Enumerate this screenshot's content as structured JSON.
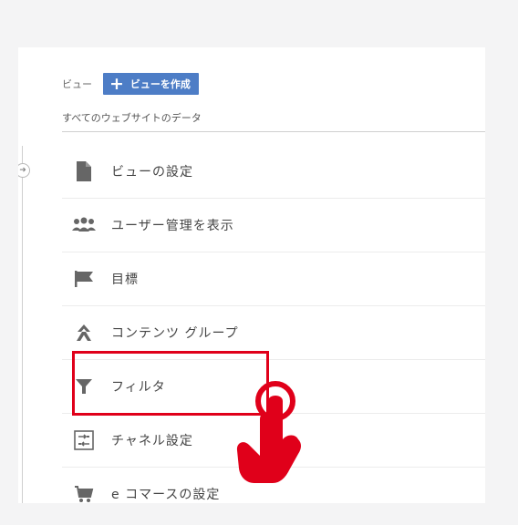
{
  "header": {
    "view_label": "ビュー",
    "create_button_label": "ビューを作成",
    "subtitle": "すべてのウェブサイトのデータ"
  },
  "menu": {
    "items": [
      {
        "label": "ビューの設定",
        "icon": "document-icon"
      },
      {
        "label": "ユーザー管理を表示",
        "icon": "users-icon"
      },
      {
        "label": "目標",
        "icon": "flag-icon"
      },
      {
        "label": "コンテンツ グループ",
        "icon": "content-group-icon"
      },
      {
        "label": "フィルタ",
        "icon": "filter-icon"
      },
      {
        "label": "チャネル設定",
        "icon": "channel-settings-icon"
      },
      {
        "label": "e コマースの設定",
        "icon": "cart-icon"
      }
    ]
  },
  "colors": {
    "accent_blue": "#4d7dc6",
    "highlight_red": "#e0001a",
    "icon_gray": "#666666"
  }
}
